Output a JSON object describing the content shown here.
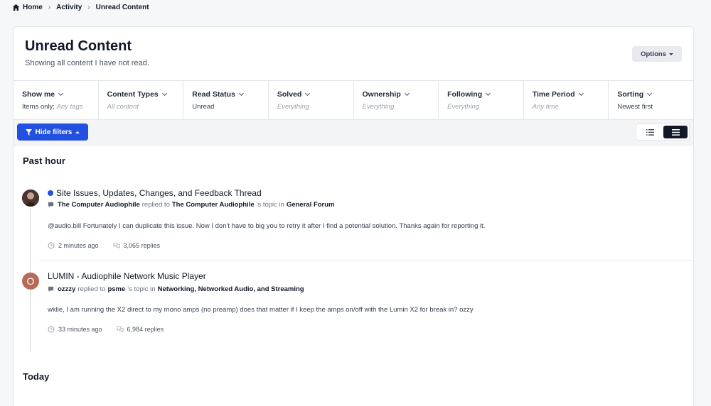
{
  "breadcrumb": {
    "home": "Home",
    "activity": "Activity",
    "current": "Unread Content"
  },
  "header": {
    "title": "Unread Content",
    "subtitle": "Showing all content I have not read.",
    "options_label": "Options"
  },
  "filters": [
    {
      "title": "Show me",
      "value": "Items only;",
      "value_muted": "Any tags"
    },
    {
      "title": "Content Types",
      "value": "",
      "value_muted": "All content"
    },
    {
      "title": "Read Status",
      "value": "Unread",
      "value_muted": ""
    },
    {
      "title": "Solved",
      "value": "",
      "value_muted": "Everything"
    },
    {
      "title": "Ownership",
      "value": "",
      "value_muted": "Everything"
    },
    {
      "title": "Following",
      "value": "",
      "value_muted": "Everything"
    },
    {
      "title": "Time Period",
      "value": "",
      "value_muted": "Any time"
    },
    {
      "title": "Sorting",
      "value": "Newest first",
      "value_muted": ""
    }
  ],
  "toolbar": {
    "hide_filters_label": "Hide filters"
  },
  "sections": {
    "past_hour": "Past hour",
    "today": "Today"
  },
  "items": [
    {
      "title": "Site Issues, Updates, Changes, and Feedback Thread",
      "author": "The Computer Audiophile",
      "action": "replied to",
      "topic_owner": "The Computer Audiophile",
      "topic_suffix": "'s topic in",
      "forum": "General Forum",
      "snippet": "@audio.bill Fortunately I can duplicate this issue. Now I don't have to big you to retry it after I find a potential solution. Thanks again for reporting it.",
      "time": "2 minutes ago",
      "replies": "3,065 replies",
      "unread": true
    },
    {
      "title": "LUMIN - Audiophile Network Music Player",
      "author": "ozzzy",
      "action": "replied to",
      "topic_owner": "psme",
      "topic_suffix": "'s topic in",
      "forum": "Networking, Networked Audio, and Streaming",
      "snippet": "wklie, I am running the X2 direct to my mono amps (no preamp) does that matter if I keep the amps on/off with the Lumin X2 for break in? ozzy",
      "time": "33 minutes ago",
      "replies": "6,984 replies",
      "avatar_letter": "O",
      "avatar_color": "#b86a58"
    }
  ],
  "colors": {
    "accent": "#2250e0",
    "unread_dot": "#2250e0"
  }
}
